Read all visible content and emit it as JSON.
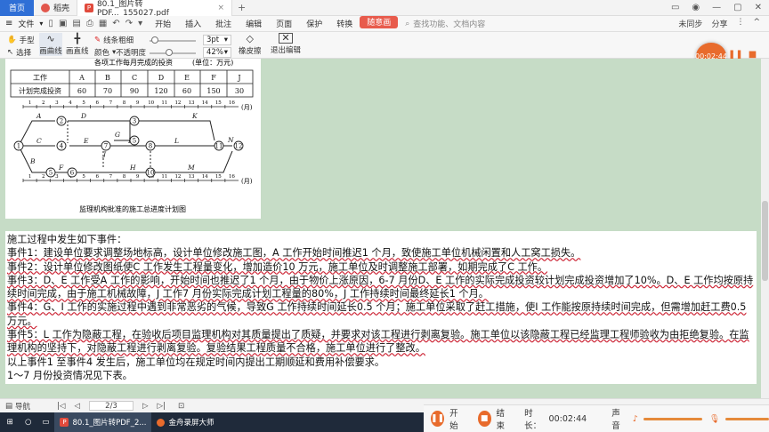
{
  "titlebar": {
    "home_tab": "首页",
    "wps_tab": "稻壳",
    "doc_tab": "80.1_图片转PDF..._155027.pdf",
    "plus": "+"
  },
  "menubar": {
    "file_label": "文件",
    "items": [
      "开始",
      "插入",
      "批注",
      "编辑",
      "页面",
      "保护",
      "转换",
      "随意画"
    ],
    "active_index": 7,
    "search_placeholder": "查找功能、文档内容",
    "right": [
      "未同步",
      "分享"
    ]
  },
  "toolbar": {
    "hand": "手型",
    "select": "选择",
    "pen": "画曲线",
    "line": "画直线",
    "line_width_label": "线条粗细",
    "color_label": "颜色",
    "opacity_label": "不透明度",
    "width_value": "3pt",
    "opacity_value": "42%",
    "eraser": "橡皮擦",
    "exit": "退出编辑"
  },
  "recording_badge": "00:02:44",
  "figure": {
    "table_title": "各项工作每月完成的投资",
    "table_unit": "(单位：万元)",
    "table_header": [
      "工作",
      "A",
      "B",
      "C",
      "D",
      "E",
      "F",
      "J"
    ],
    "table_row_label": "计划完成投资",
    "table_values": [
      "60",
      "70",
      "90",
      "120",
      "60",
      "150",
      "30"
    ],
    "month_unit": "(月)",
    "caption": "监理机构批准的施工总进度计划图",
    "activities": [
      "A",
      "D",
      "K",
      "G",
      "C",
      "E",
      "I",
      "L",
      "N",
      "B",
      "F",
      "H",
      "M",
      "J"
    ],
    "nodes": [
      "1",
      "2",
      "3",
      "4",
      "5",
      "6",
      "7",
      "8",
      "9",
      "10",
      "11",
      "12"
    ],
    "axis_months": [
      "1",
      "2",
      "3",
      "4",
      "5",
      "6",
      "7",
      "8",
      "9",
      "10",
      "11",
      "12",
      "13",
      "14",
      "15",
      "16"
    ]
  },
  "document": {
    "lines": [
      "施工过程中发生如下事件：",
      "事件1：建设单位要求调整场地标高，设计单位修改施工图，A 工作开始时间推迟1 个月，致使施工单位机械闲置和人工窝工损失。",
      "事件2：设计单位修改图纸使C 工作发生工程量变化，增加造价10 万元，施工单位及时调整施工部署，如期完成了C 工作。",
      "事件3：D、E 工作受A 工作的影响，开始时间也推迟了1 个月，由于物价上涨原因，6-7 月份D、E 工作的实际完成投资较计划完成投资增加了10%。D、E 工作均按原持续时间完成，由于施工机械故障，J 工作7 月份实际完成计划工程量的80%，J 工作持续时间最终延长1 个月。",
      "事件4：G、I 工作的实施过程中遇到非常恶劣的气候，导致G 工作持续时间延长0.5 个月；施工单位采取了赶工措施，使I 工作能按原持续时间完成，但需增加赶工费0.5 万元。",
      "事件5：L 工作为隐蔽工程，在验收后项目监理机构对其质量提出了质疑，并要求对该工程进行剥离复验。施工单位以该隐蔽工程已经监理工程师验收为由拒绝复验。在监理机构的坚持下，对隐蔽工程进行剥离复验。复验结果工程质量不合格，施工单位进行了整改。",
      "以上事件1 至事件4 发生后，施工单位均在规定时间内提出工期顺延和费用补偿要求。",
      "1～7 月份投资情况见下表。"
    ]
  },
  "statusbar": {
    "nav": "导航",
    "page": "2/3"
  },
  "taskbar": {
    "items": [
      "80.1_图片转PDF_2...",
      "金舟录屏大师"
    ]
  },
  "recorder": {
    "start": "开始",
    "end": "结束",
    "duration_label": "时长：",
    "duration": "00:02:44",
    "volume_label": "声音"
  }
}
